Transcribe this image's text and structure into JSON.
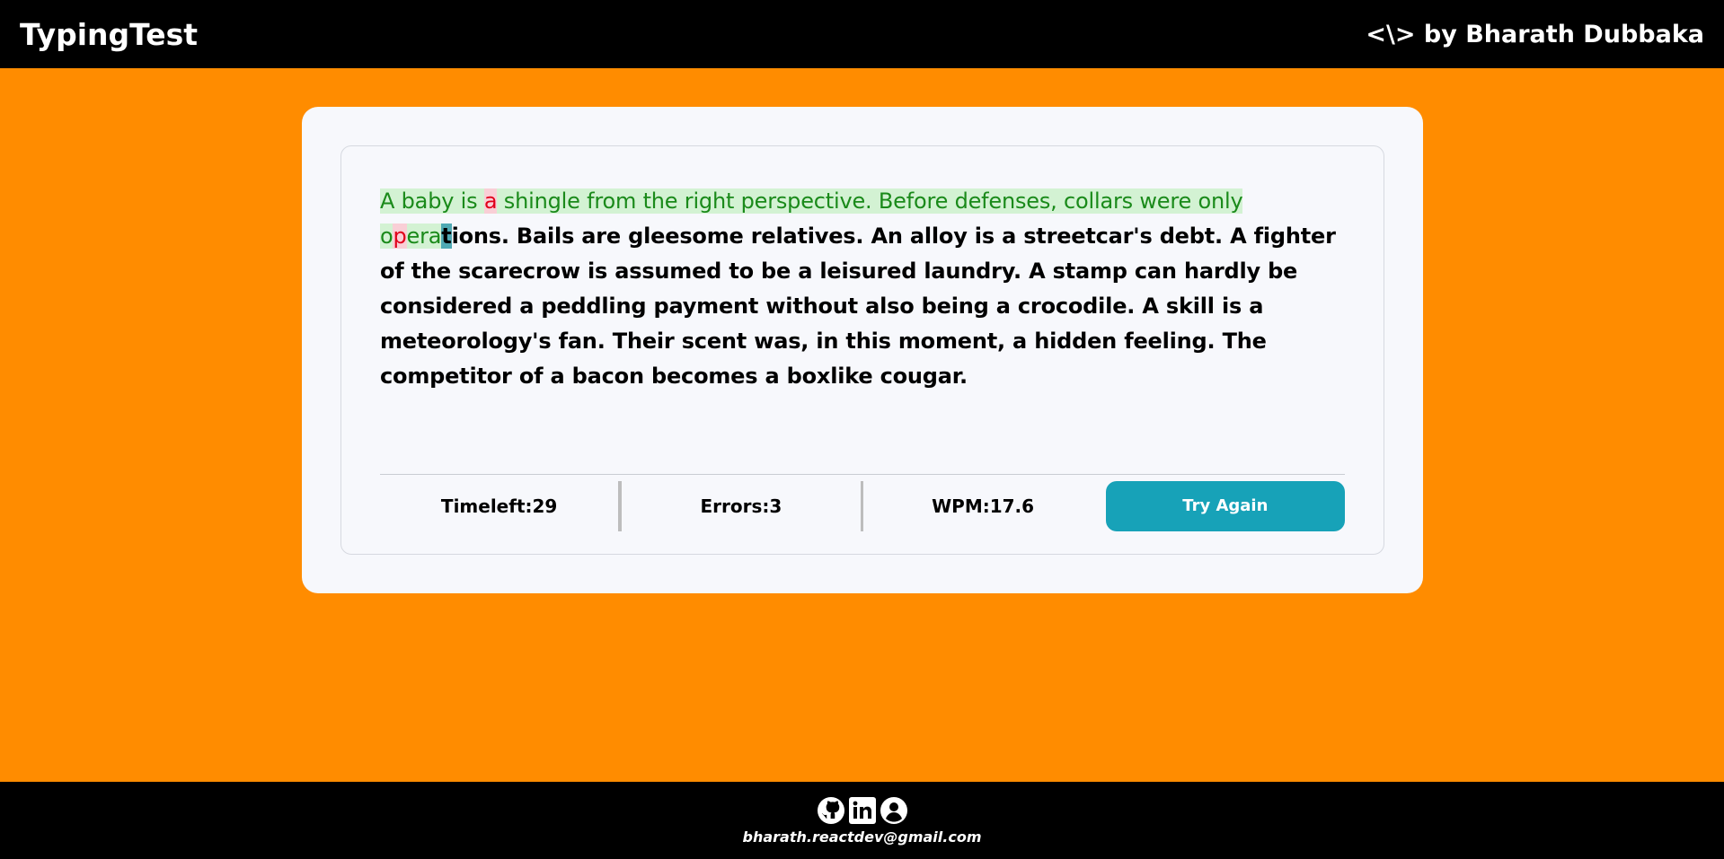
{
  "header": {
    "brand": "TypingTest",
    "author": "<\\> by Bharath Dubbaka"
  },
  "passage": {
    "typed_segments": [
      {
        "text": "A baby is ",
        "state": "correct"
      },
      {
        "text": "a",
        "state": "incorrect"
      },
      {
        "text": " shingle from the right perspective. Before defenses, collars were only ",
        "state": "correct"
      },
      {
        "text": "o",
        "state": "correct"
      },
      {
        "text": "p",
        "state": "incorrect"
      },
      {
        "text": "era",
        "state": "correct"
      }
    ],
    "cursor_char": "t",
    "remaining": "ions. Bails are gleesome relatives. An alloy is a streetcar's debt. A fighter of the scarecrow is assumed to be a leisured laundry. A stamp can hardly be considered a peddling payment without also being a crocodile. A skill is a meteorology's fan. Their scent was, in this moment, a hidden feeling. The competitor of a bacon becomes a boxlike cougar."
  },
  "stats": {
    "timeleft": "Timeleft:29",
    "errors": "Errors:3",
    "wpm": "WPM:17.6",
    "try_again_label": "Try Again"
  },
  "footer": {
    "icons": [
      "github-icon",
      "linkedin-icon",
      "profile-icon"
    ],
    "email": "bharath.reactdev@gmail.com"
  },
  "colors": {
    "background": "#ff8c00",
    "bars": "#000000",
    "card": "#f7f8fc",
    "correct_text": "#1a8a1a",
    "correct_bg": "#d3f2d3",
    "incorrect_text": "#e0001a",
    "incorrect_bg": "#f9cfd6",
    "cursor_bg": "#4fa9b3",
    "button": "#17a2b8"
  }
}
